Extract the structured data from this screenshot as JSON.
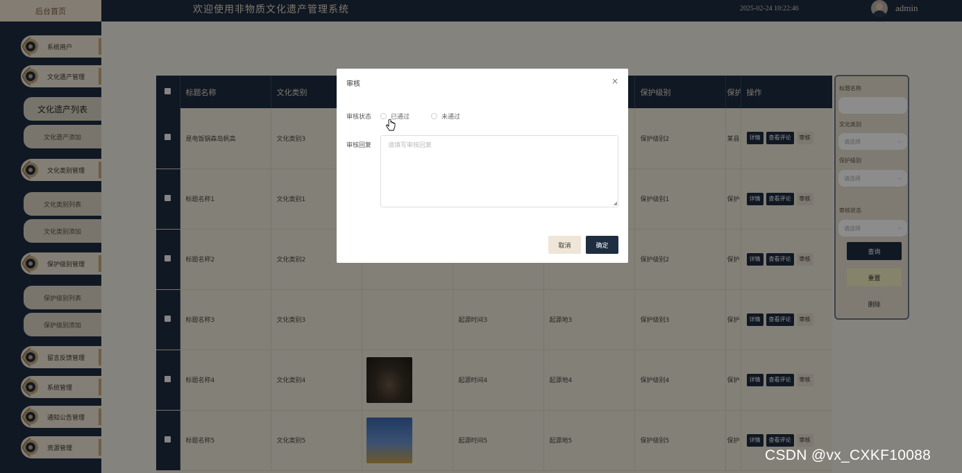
{
  "header": {
    "home_tab": "后台首页",
    "title": "欢迎使用非物质文化遗产管理系统",
    "datetime": "2025-02-24 10:22:46",
    "username": "admin"
  },
  "sidebar": {
    "groups": [
      {
        "label": "系统用户"
      },
      {
        "label": "文化遗产管理"
      },
      {
        "label": "文化类别管理"
      },
      {
        "label": "保护级别管理"
      },
      {
        "label": "留言反馈管理"
      },
      {
        "label": "系统管理"
      },
      {
        "label": "通知公告管理"
      },
      {
        "label": "资源管理"
      }
    ],
    "subitems": [
      {
        "label": "文化遗产列表"
      },
      {
        "label": "文化遗产添加"
      },
      {
        "label": "文化类别列表"
      },
      {
        "label": "文化类别添加"
      },
      {
        "label": "保护级别列表"
      },
      {
        "label": "保护级别添加"
      }
    ]
  },
  "table": {
    "headers": [
      "标题名称",
      "文化类别",
      "",
      "",
      "",
      "保护级别",
      "保护",
      "操作"
    ],
    "rows": [
      {
        "title": "是电饭锅森岛帆高",
        "category": "文化类别3",
        "time": "",
        "origin": "",
        "level": "保护级别2",
        "extra": "某县"
      },
      {
        "title": "标题名称1",
        "category": "文化类别1",
        "time": "",
        "origin": "",
        "level": "保护级别1",
        "extra": "保护"
      },
      {
        "title": "标题名称2",
        "category": "文化类别2",
        "time": "",
        "origin": "",
        "level": "保护级别2",
        "extra": "保护"
      },
      {
        "title": "标题名称3",
        "category": "文化类别3",
        "time": "起源时间3",
        "origin": "起源地3",
        "level": "保护级别3",
        "extra": "保护"
      },
      {
        "title": "标题名称4",
        "category": "文化类别4",
        "time": "起源时间4",
        "origin": "起源地4",
        "level": "保护级别4",
        "extra": "保护"
      },
      {
        "title": "标题名称5",
        "category": "文化类别5",
        "time": "起源时间5",
        "origin": "起源地5",
        "level": "保护级别5",
        "extra": "保护"
      }
    ],
    "ops": {
      "detail": "详情",
      "comments": "查看评论",
      "audit": "审核"
    }
  },
  "filter": {
    "title_label": "标题名称",
    "category_label": "文化类别",
    "category_placeholder": "请选择",
    "level_label": "保护级别",
    "level_placeholder": "请选择",
    "status_label": "审核状态",
    "status_placeholder": "请选择",
    "search": "查询",
    "reset": "重置",
    "delete": "删除"
  },
  "modal": {
    "title": "审核",
    "close": "×",
    "status_label": "审核状态",
    "option_pass": "已通过",
    "option_fail": "未通过",
    "reply_label": "审核回复",
    "reply_placeholder": "请填写审核回复",
    "cancel": "取消",
    "confirm": "确定"
  },
  "watermark": "CSDN @vx_CXKF10088",
  "colors": {
    "navy": "#1e2d40",
    "beige": "#efe6d7"
  }
}
